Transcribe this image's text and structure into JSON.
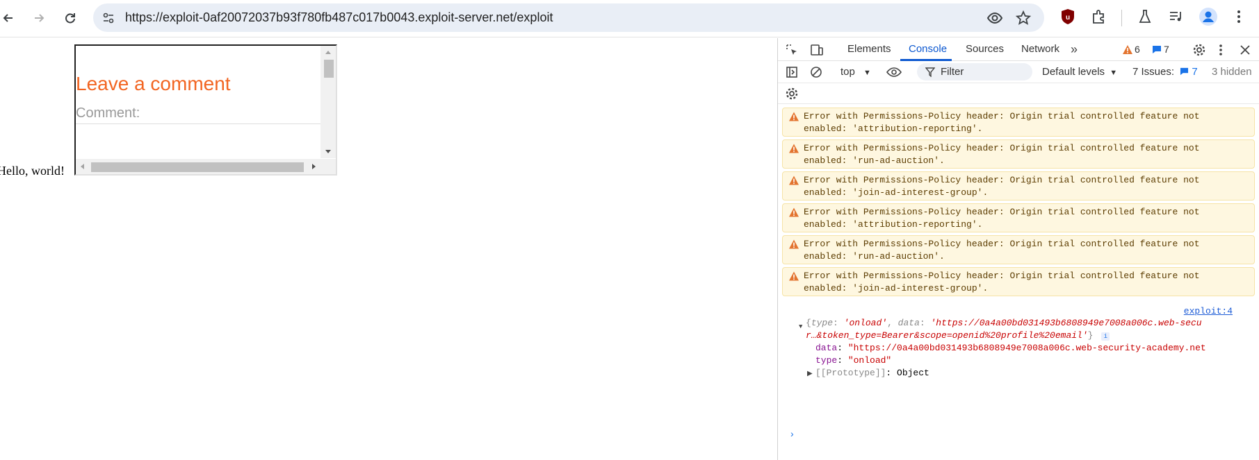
{
  "browser": {
    "url": "https://exploit-0af20072037b93f780fb487c017b0043.exploit-server.net/exploit",
    "buttons": {
      "back": "back-arrow-icon",
      "forward": "forward-arrow-icon",
      "reload": "reload-icon"
    }
  },
  "page": {
    "hello_text": "Hello, world!",
    "iframe": {
      "heading": "Leave a comment",
      "label": "Comment:"
    }
  },
  "devtools": {
    "tabs": [
      "Elements",
      "Console",
      "Sources",
      "Network"
    ],
    "active_tab": "Console",
    "warning_count": "6",
    "message_count": "7",
    "context": "top",
    "filter_placeholder": "Filter",
    "levels": "Default levels",
    "issues_label": "7 Issues:",
    "issues_count": "7",
    "hidden": "3 hidden",
    "warnings": [
      {
        "line1": "Error with Permissions-Policy header: Origin trial controlled feature not",
        "line2": "enabled: 'attribution-reporting'."
      },
      {
        "line1": "Error with Permissions-Policy header: Origin trial controlled feature not",
        "line2": "enabled: 'run-ad-auction'."
      },
      {
        "line1": "Error with Permissions-Policy header: Origin trial controlled feature not",
        "line2": "enabled: 'join-ad-interest-group'."
      },
      {
        "line1": "Error with Permissions-Policy header: Origin trial controlled feature not",
        "line2": "enabled: 'attribution-reporting'."
      },
      {
        "line1": "Error with Permissions-Policy header: Origin trial controlled feature not",
        "line2": "enabled: 'run-ad-auction'."
      },
      {
        "line1": "Error with Permissions-Policy header: Origin trial controlled feature not",
        "line2": "enabled: 'join-ad-interest-group'."
      }
    ],
    "log": {
      "source": "exploit:4",
      "summary_type_key": "type",
      "summary_type_val": "'onload'",
      "summary_data_key": "data",
      "summary_data_val": "'https://0a4a00bd031493b6808949e7008a006c.web-secu",
      "summary_line2": "r…&token_type=Bearer&scope=openid%20profile%20email'",
      "data_key": "data",
      "data_val": "\"https://0a4a00bd031493b6808949e7008a006c.web-security-academy.net",
      "type_key": "type",
      "type_val": "\"onload\"",
      "proto_key": "[[Prototype]]",
      "proto_val": "Object"
    },
    "prompt": "›"
  }
}
